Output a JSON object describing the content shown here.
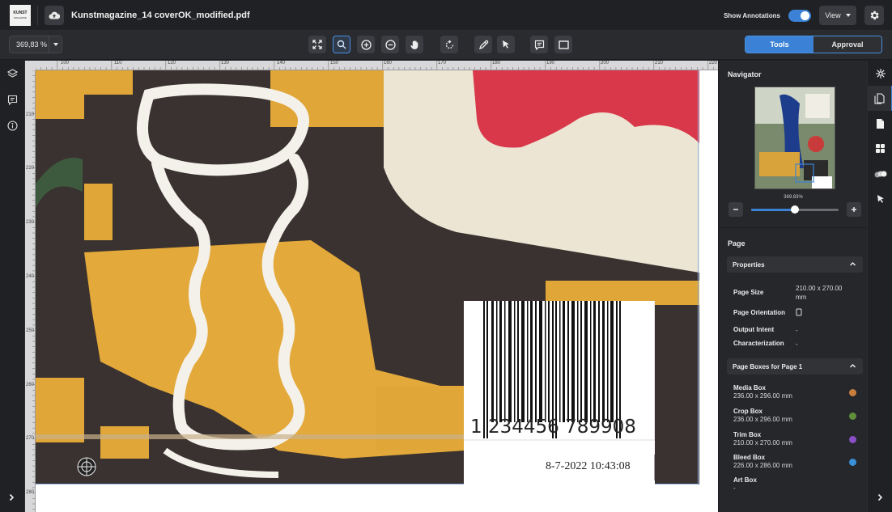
{
  "topbar": {
    "logo_line1": "KUNST",
    "logo_line2": "MAGAZINE",
    "filename": "Kunstmagazine_14 coverOK_modified.pdf",
    "show_annotations_label": "Show Annotations",
    "show_annotations_on": true,
    "view_label": "View"
  },
  "toolbar": {
    "zoom_value": "369,83 %",
    "tabs": [
      {
        "label": "Tools",
        "active": true
      },
      {
        "label": "Approval",
        "active": false
      }
    ]
  },
  "rulers": {
    "top_ticks": [
      "100",
      "110",
      "120",
      "130",
      "140",
      "150",
      "160",
      "170",
      "180",
      "190",
      "200",
      "210",
      "220"
    ],
    "left_ticks": [
      "210",
      "220",
      "230",
      "240",
      "250",
      "260",
      "270",
      "280"
    ]
  },
  "canvas": {
    "barcode_number": "1 234456 789908",
    "stamp": "8-7-2022   10:43:08"
  },
  "navigator": {
    "title": "Navigator",
    "zoom_percent": "369.83%",
    "slider_level": 0.5
  },
  "page_panel": {
    "title": "Page",
    "properties_header": "Properties",
    "properties": [
      {
        "label": "Page Size",
        "value": "210.00 x 270.00 mm"
      },
      {
        "label": "Page Orientation",
        "value": ""
      },
      {
        "label": "Output Intent",
        "value": "-"
      },
      {
        "label": "Characterization",
        "value": "-"
      }
    ],
    "boxes_header": "Page Boxes for Page 1",
    "boxes": [
      {
        "name": "Media Box",
        "size": "236.00 x 296.00 mm",
        "color": "#c87f3e"
      },
      {
        "name": "Crop Box",
        "size": "236.00 x 296.00 mm",
        "color": "#5f8f3a"
      },
      {
        "name": "Trim Box",
        "size": "210.00 x 270.00 mm",
        "color": "#8a4fc7"
      },
      {
        "name": "Bleed Box",
        "size": "226.00 x 286.00 mm",
        "color": "#3a8fd9"
      },
      {
        "name": "Art Box",
        "size": "-",
        "color": ""
      }
    ]
  },
  "colors": {
    "accent": "#3b82d6",
    "background": "#1f2023",
    "panel": "#26272b"
  },
  "icons": {
    "left_rail": [
      "layers-icon",
      "comment-icon",
      "info-icon"
    ],
    "right_rail": [
      "sparkle-icon",
      "pages-icon",
      "document-icon",
      "grid-icon",
      "separations-icon",
      "pointer-icon"
    ]
  }
}
